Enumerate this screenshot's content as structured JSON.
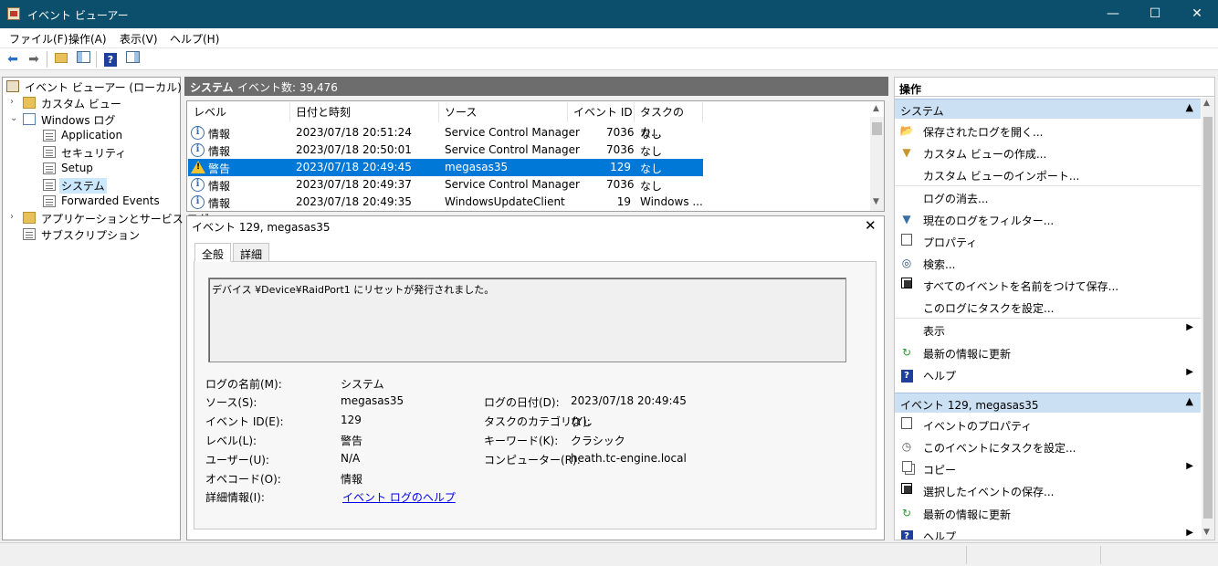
{
  "window": {
    "title": "イベント ビューアー",
    "minimize": "—",
    "maximize": "☐",
    "close": "✕"
  },
  "menu": [
    "ファイル(F)",
    "操作(A)",
    "表示(V)",
    "ヘルプ(H)"
  ],
  "toolbar": {
    "icons": [
      "back-icon",
      "forward-icon",
      "up-folder-icon",
      "show-hide-tree-icon",
      "help-icon",
      "show-hide-action-icon"
    ]
  },
  "tree": {
    "root": "イベント ビューアー (ローカル)",
    "custom_views": "カスタム ビュー",
    "windows_logs": "Windows ログ",
    "application": "Application",
    "security": "セキュリティ",
    "setup": "Setup",
    "system": "システム",
    "forwarded": "Forwarded Events",
    "apps_services": "アプリケーションとサービス ログ",
    "subscriptions": "サブスクリプション"
  },
  "center": {
    "title": "システム",
    "count": "イベント数: 39,476",
    "columns": [
      "レベル",
      "日付と時刻",
      "ソース",
      "イベント ID",
      "タスクのカ..."
    ],
    "rows": [
      {
        "level": "情報",
        "date": "2023/07/18 20:51:24",
        "source": "Service Control Manager",
        "id": "7036",
        "task": "なし",
        "type": "info"
      },
      {
        "level": "情報",
        "date": "2023/07/18 20:50:01",
        "source": "Service Control Manager",
        "id": "7036",
        "task": "なし",
        "type": "info"
      },
      {
        "level": "警告",
        "date": "2023/07/18 20:49:45",
        "source": "megasas35",
        "id": "129",
        "task": "なし",
        "type": "warn"
      },
      {
        "level": "情報",
        "date": "2023/07/18 20:49:37",
        "source": "Service Control Manager",
        "id": "7036",
        "task": "なし",
        "type": "info"
      },
      {
        "level": "情報",
        "date": "2023/07/18 20:49:35",
        "source": "WindowsUpdateClient",
        "id": "19",
        "task": "Windows ...",
        "type": "info"
      }
    ]
  },
  "detail": {
    "title": "イベント 129, megasas35",
    "tabs": [
      "全般",
      "詳細"
    ],
    "description": "デバイス ¥Device¥RaidPort1 にリセットが発行されました。",
    "fields": {
      "log_name_label": "ログの名前(M):",
      "log_name": "システム",
      "source_label": "ソース(S):",
      "source": "megasas35",
      "logged_label": "ログの日付(D):",
      "logged": "2023/07/18 20:49:45",
      "event_id_label": "イベント ID(E):",
      "event_id": "129",
      "task_label": "タスクのカテゴリ(Y):",
      "task": "なし",
      "level_label": "レベル(L):",
      "level": "警告",
      "keywords_label": "キーワード(K):",
      "keywords": "クラシック",
      "user_label": "ユーザー(U):",
      "user": "N/A",
      "computer_label": "コンピューター(R):",
      "computer": "heath.tc-engine.local",
      "opcode_label": "オペコード(O):",
      "opcode": "情報",
      "more_label": "詳細情報(I):",
      "more_link": "イベント ログのヘルプ"
    }
  },
  "actions": {
    "title": "操作",
    "group1": "システム",
    "items1": [
      "保存されたログを開く...",
      "カスタム ビューの作成...",
      "カスタム ビューのインポート...",
      "ログの消去...",
      "現在のログをフィルター...",
      "プロパティ",
      "検索...",
      "すべてのイベントを名前をつけて保存...",
      "このログにタスクを設定...",
      "表示",
      "最新の情報に更新",
      "ヘルプ"
    ],
    "group2": "イベント 129, megasas35",
    "items2": [
      "イベントのプロパティ",
      "このイベントにタスクを設定...",
      "コピー",
      "選択したイベントの保存...",
      "最新の情報に更新",
      "ヘルプ"
    ]
  }
}
